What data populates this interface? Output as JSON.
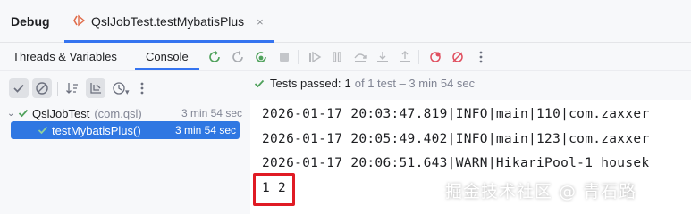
{
  "header": {
    "tool_title": "Debug",
    "run_tab_label": "QslJobTest.testMybatisPlus",
    "close_glyph": "×"
  },
  "subtabs": {
    "threads_label": "Threads & Variables",
    "console_label": "Console"
  },
  "status": {
    "label": "Tests passed:",
    "count": "1",
    "detail": "of 1 test – 3 min 54 sec"
  },
  "tree": {
    "root": {
      "name": "QslJobTest",
      "package": "(com.qsl)",
      "time": "3 min 54 sec"
    },
    "child": {
      "name": "testMybatisPlus()",
      "time": "3 min 54 sec"
    }
  },
  "console": {
    "lines": [
      "2026-01-17 20:03:47.819|INFO|main|110|com.zaxxer",
      "2026-01-17 20:05:49.402|INFO|main|123|com.zaxxer",
      "2026-01-17 20:06:51.643|WARN|HikariPool-1 housek",
      "1 2"
    ]
  },
  "watermark": "掘金技术社区 @ 青石路",
  "colors": {
    "accent": "#3574f0",
    "pass_green": "#4fa15b",
    "selected_bg": "#2f77e2",
    "highlight_red": "#e01b24"
  },
  "icons": [
    "debug-run-icon",
    "close-icon",
    "rerun-icon",
    "rerun-failed-icon",
    "stop-icon",
    "resume-icon",
    "pause-icon",
    "step-over-icon",
    "step-into-icon",
    "step-out-icon",
    "breakpoints-icon",
    "mute-breakpoints-icon",
    "more-icon",
    "show-passed-icon",
    "show-ignored-icon",
    "sort-icon",
    "collapse-icon",
    "history-icon",
    "check-icon",
    "expand-arrow-icon"
  ]
}
